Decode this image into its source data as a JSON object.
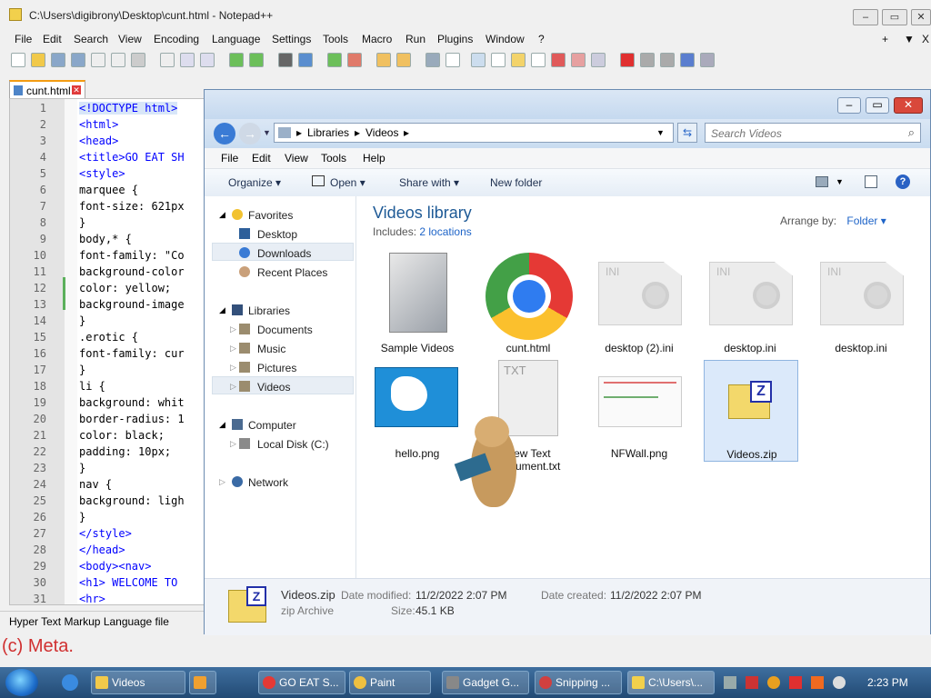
{
  "npp": {
    "title": "C:\\Users\\digibrony\\Desktop\\cunt.html - Notepad++",
    "menu": [
      "File",
      "Edit",
      "Search",
      "View",
      "Encoding",
      "Language",
      "Settings",
      "Tools",
      "Macro",
      "Run",
      "Plugins",
      "Window",
      "?"
    ],
    "menu_right": [
      "+",
      "▼",
      "X"
    ],
    "tab_label": "cunt.html",
    "line_numbers": [
      "1",
      "2",
      "3",
      "4",
      "5",
      "6",
      "7",
      "8",
      "9",
      "10",
      "11",
      "12",
      "13",
      "14",
      "15",
      "16",
      "17",
      "18",
      "19",
      "20",
      "21",
      "22",
      "23",
      "24",
      "25",
      "26",
      "27",
      "28",
      "29",
      "30",
      "31"
    ],
    "code_lines": [
      "<!DOCTYPE html>",
      "<html>",
      "<head>",
      "<title>GO EAT SH",
      "<style>",
      "marquee {",
      "font-size: 621px",
      "}",
      "body,* {",
      "font-family: \"Co",
      "background-color",
      "color: yellow;",
      "background-image",
      "}",
      ".erotic {",
      "font-family: cur",
      "}",
      "li {",
      "background: whit",
      "border-radius: 1",
      "color: black;",
      "padding: 10px;",
      "}",
      "nav {",
      "background: ligh",
      "}",
      "</style>",
      "</head>",
      "<body><nav>",
      "<h1> WELCOME TO",
      "<hr>"
    ],
    "status": "Hyper Text Markup Language file"
  },
  "bg_text": "(c) Meta.",
  "explorer": {
    "breadcrumb": [
      "Libraries",
      "Videos"
    ],
    "search_placeholder": "Search Videos",
    "menu": [
      "File",
      "Edit",
      "View",
      "Tools",
      "Help"
    ],
    "commands": [
      "Organize ▾",
      "Open ▾",
      "Share with ▾",
      "New folder"
    ],
    "nav": {
      "favorites": "Favorites",
      "favorites_items": [
        "Desktop",
        "Downloads",
        "Recent Places"
      ],
      "libraries": "Libraries",
      "libraries_items": [
        "Documents",
        "Music",
        "Pictures",
        "Videos"
      ],
      "computer": "Computer",
      "computer_items": [
        "Local Disk (C:)"
      ],
      "network": "Network"
    },
    "library_title": "Videos library",
    "includes_label": "Includes:",
    "includes_link": "2 locations",
    "arrange_label": "Arrange by:",
    "arrange_value": "Folder ▾",
    "files": [
      "Sample Videos",
      "cunt.html",
      "desktop (2).ini",
      "desktop.ini",
      "desktop.ini",
      "hello.png",
      "New Text Document.txt",
      "NFWall.png",
      "Videos.zip"
    ],
    "details": {
      "name": "Videos.zip",
      "type": "zip Archive",
      "modified_label": "Date modified:",
      "modified": "11/2/2022 2:07 PM",
      "created_label": "Date created:",
      "created": "11/2/2022 2:07 PM",
      "size_label": "Size:",
      "size": "45.1 KB"
    }
  },
  "taskbar": {
    "items": [
      "Videos",
      "",
      "GO EAT S...",
      "Paint",
      "Gadget G...",
      "Snipping ...",
      "C:\\Users\\..."
    ],
    "clock": "2:23 PM"
  }
}
